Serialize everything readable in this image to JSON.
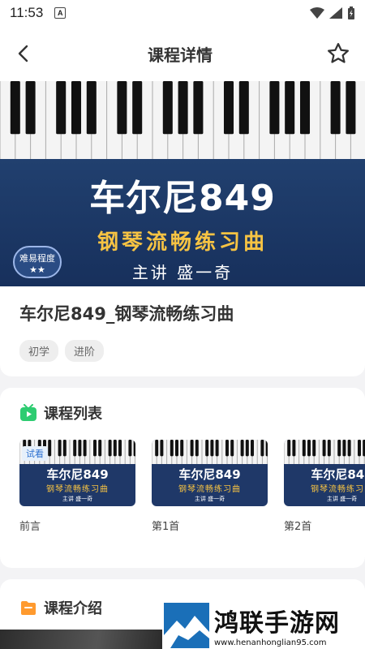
{
  "status": {
    "time": "11:53"
  },
  "nav": {
    "title": "课程详情"
  },
  "banner": {
    "title": "车尔尼849",
    "subtitle": "钢琴流畅练习曲",
    "teacher": "主讲  盛一奇",
    "difficulty": "难易程度",
    "stars": "★★"
  },
  "course": {
    "title": "车尔尼849_钢琴流畅练习曲",
    "tags": [
      "初学",
      "进阶"
    ]
  },
  "list": {
    "header": "课程列表",
    "lessons": [
      {
        "name": "前言",
        "badge": "试看"
      },
      {
        "name": "第1首",
        "badge": ""
      },
      {
        "name": "第2首",
        "badge": ""
      }
    ],
    "thumb": {
      "title": "车尔尼849",
      "subtitle": "钢琴流畅练习曲",
      "teacher": "主讲  盛一奇"
    }
  },
  "intro": {
    "header": "课程介绍"
  },
  "watermark": {
    "name": "鸿联手游网",
    "url": "www.henanhonglian95.com"
  },
  "colors": {
    "accent_green": "#2ecc71",
    "accent_orange": "#ff9a2e",
    "banner_blue": "#1f3868",
    "banner_gold": "#f6c343"
  }
}
